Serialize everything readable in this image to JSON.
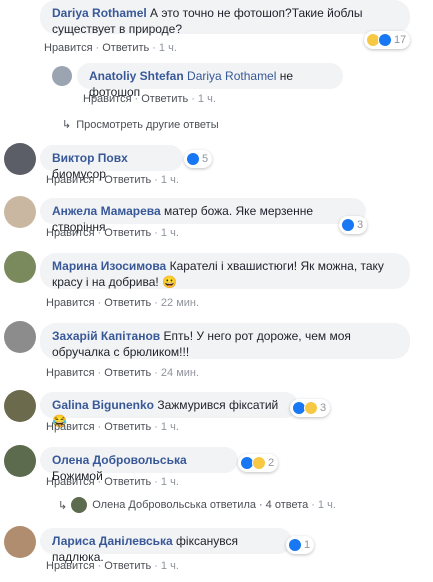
{
  "actions": {
    "like": "Нравится",
    "reply": "Ответить",
    "dot": "·"
  },
  "comments": [
    {
      "name": "Dariya Rothamel",
      "text": "А это точно не фотошоп?Такие йоблы существует в природе?",
      "time": "1 ч.",
      "reactions": {
        "types": [
          "haha",
          "like"
        ],
        "count": "17"
      }
    },
    {
      "name": "Anatoliy Shtefan",
      "mention": "Dariya Rothamel",
      "text": "не фотошоп",
      "time": "1 ч."
    },
    {
      "name": "Виктор Повх",
      "text": "биомусор",
      "time": "1 ч.",
      "reactions": {
        "types": [
          "like"
        ],
        "count": "5"
      }
    },
    {
      "name": "Анжела Мамарева",
      "text": "матер божа. Яке мерзенне створіння",
      "time": "1 ч.",
      "reactions": {
        "types": [
          "like"
        ],
        "count": "3"
      }
    },
    {
      "name": "Марина Изосимова",
      "text": "Карателі і хвашистюги! Як можна, таку красу і на добрива! 😀",
      "time": "22 мин."
    },
    {
      "name": "Захарій Капітанов",
      "text": "Епть! У него рот дороже, чем моя обручалка с брюликом!!!",
      "time": "24 мин."
    },
    {
      "name": "Galina Bigunenko",
      "text": "Зажмурився фіксатий 😂",
      "time": "1 ч.",
      "reactions": {
        "types": [
          "like",
          "haha"
        ],
        "count": "3"
      }
    },
    {
      "name": "Олена Добровольська",
      "text": "Божимой",
      "time": "1 ч.",
      "reactions": {
        "types": [
          "like",
          "haha"
        ],
        "count": "2"
      }
    },
    {
      "name": "Лариса Данілевська",
      "text": "фіксанувся падлюка.",
      "time": "1 ч.",
      "reactions": {
        "types": [
          "like"
        ],
        "count": "1"
      }
    }
  ],
  "more_replies": {
    "label": "Просмотреть другие ответы"
  },
  "reply_summary": {
    "name": "Олена Добровольська",
    "verb": "ответила",
    "count": "4 ответа",
    "time": "1 ч."
  },
  "colors": {
    "name": "#385898",
    "bubble": "#f2f3f5",
    "meta": "#90949c",
    "like": "#1877f2",
    "haha": "#f7c844"
  }
}
